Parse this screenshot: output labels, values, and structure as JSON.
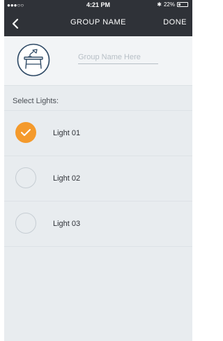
{
  "status_bar": {
    "carrier": "●●●○○",
    "time": "4:21 PM",
    "bluetooth": "✱",
    "battery_percent": "22%",
    "battery_level": 0.22
  },
  "nav_bar": {
    "back_icon": "chevron-left-icon",
    "title": "GROUP NAME",
    "done_label": "DONE"
  },
  "group": {
    "icon": "table-lamp-icon",
    "name_placeholder": "Group Name Here",
    "name_value": ""
  },
  "lights_section": {
    "label": "Select Lights:",
    "items": [
      {
        "label": "Light 01",
        "selected": true
      },
      {
        "label": "Light 02",
        "selected": false
      },
      {
        "label": "Light 03",
        "selected": false
      }
    ]
  },
  "colors": {
    "bar_background": "#2f3238",
    "content_background": "#e8ecef",
    "accent": "#f49a2c"
  }
}
